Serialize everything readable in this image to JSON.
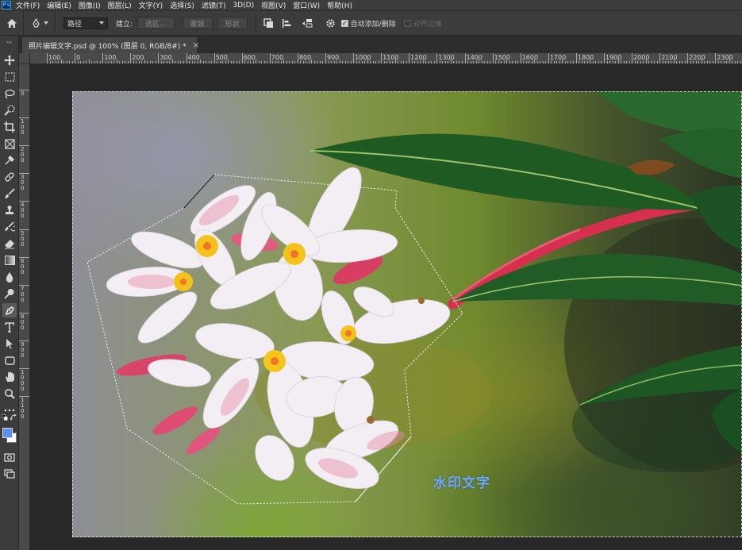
{
  "app": {
    "logo": "Ps"
  },
  "menu": [
    "文件(F)",
    "编辑(E)",
    "图像(I)",
    "图层(L)",
    "文字(Y)",
    "选择(S)",
    "滤镜(T)",
    "3D(D)",
    "视图(V)",
    "窗口(W)",
    "帮助(H)"
  ],
  "options": {
    "mode_value": "路径",
    "make_label": "建立:",
    "selection_btn": "选区...",
    "mask_btn": "蒙版",
    "shape_btn": "形状",
    "auto_add_delete_label": "自动添加/删除",
    "auto_add_delete_checked": true,
    "align_edges_label": "对齐边缘",
    "align_edges_checked": false
  },
  "document": {
    "tab_title": "照片编辑文字.psd @ 100% (图层 0, RGB/8#) *",
    "close_symbol": "×"
  },
  "ruler": {
    "top_labels": [
      "100",
      "0",
      "100",
      "200",
      "300",
      "400",
      "500",
      "600",
      "700",
      "800",
      "900",
      "1000",
      "1100",
      "1200",
      "1300",
      "1400",
      "1500",
      "1600",
      "1700",
      "1800",
      "1900",
      "2000",
      "2100",
      "2200",
      "2300"
    ],
    "left_labels": [
      "0",
      "1 0 0",
      "2 0 0",
      "3 0 0",
      "4 0 0",
      "5 0 0",
      "6 0 0",
      "7 0 0",
      "8 0 0",
      "9 0 0",
      "1 0 0 0",
      "1 1 0 0"
    ]
  },
  "canvas": {
    "watermark_text": "水印文字",
    "watermark_color": "#6fa7ff"
  },
  "colors": {
    "foreground": "#5b8ff0",
    "background": "#ffffff",
    "ui_panel": "#3c3c3c",
    "ui_dark": "#282828"
  },
  "tools": [
    "move-icon",
    "marquee-icon",
    "lasso-icon",
    "quick-select-icon",
    "crop-icon",
    "frame-icon",
    "eyedropper-icon",
    "healing-brush-icon",
    "brush-icon",
    "stamp-icon",
    "history-brush-icon",
    "eraser-icon",
    "gradient-icon",
    "blur-icon",
    "dodge-icon",
    "pen-icon",
    "type-icon",
    "path-select-icon",
    "rectangle-icon",
    "hand-icon",
    "zoom-icon",
    "more-icon"
  ]
}
